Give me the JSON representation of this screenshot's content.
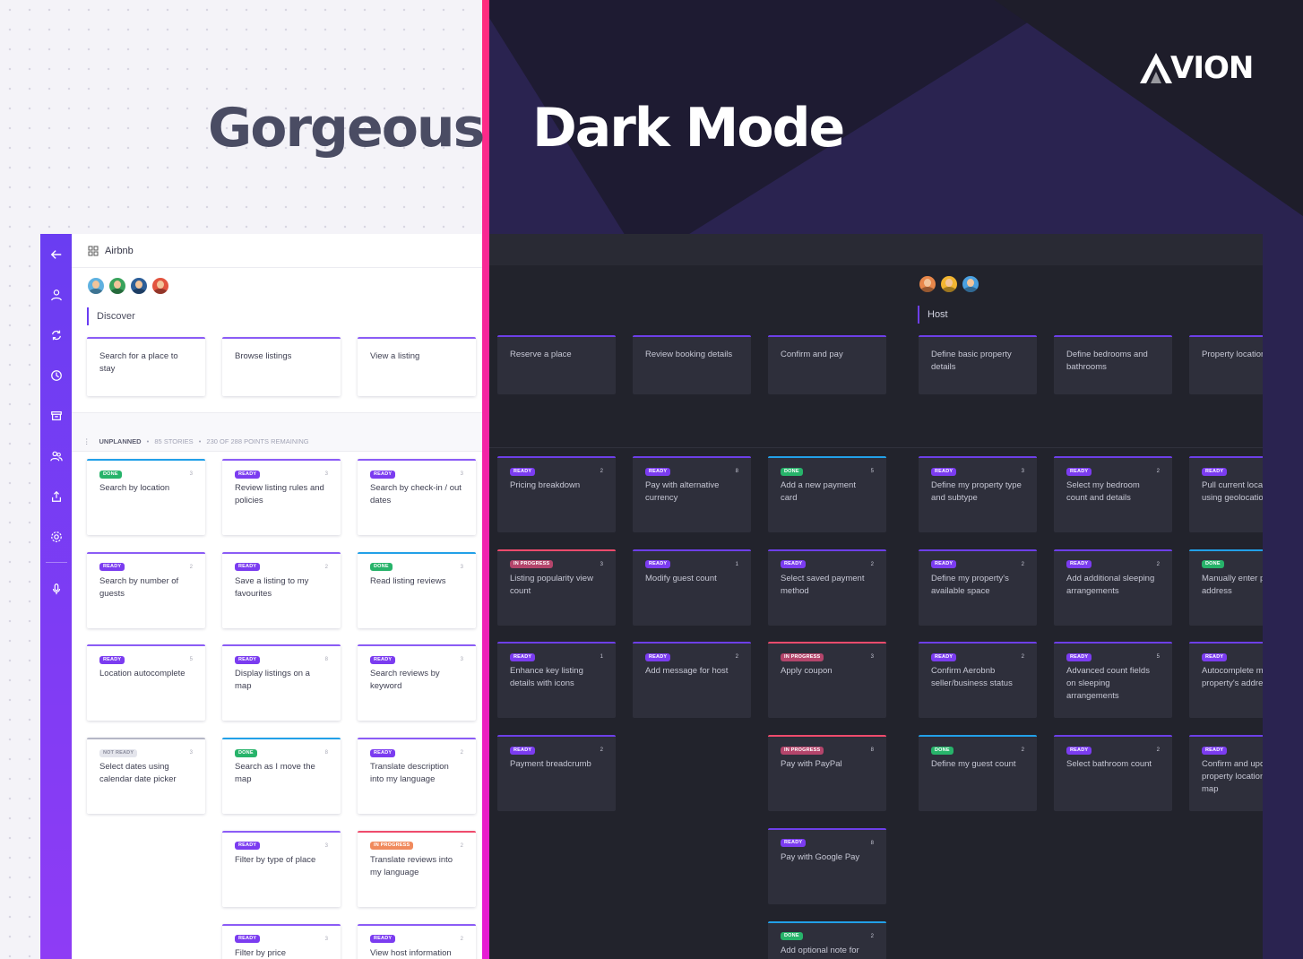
{
  "headline_left": "Gorgeous",
  "headline_right": "Dark Mode",
  "brand": "VION",
  "light_app": {
    "project": "Airbnb",
    "activity": "Discover",
    "steps": [
      "Search for a place to stay",
      "Browse listings",
      "View a listing"
    ],
    "unplanned": {
      "label": "UNPLANNED",
      "stories": "85 STORIES",
      "points": "230 OF 288 POINTS REMAINING"
    },
    "columns": [
      [
        {
          "status": "DONE",
          "pts": "3",
          "title": "Search by location"
        },
        {
          "status": "READY",
          "pts": "2",
          "title": "Search by number of guests"
        },
        {
          "status": "READY",
          "pts": "5",
          "title": "Location autocomplete"
        },
        {
          "status": "NOT READY",
          "pts": "3",
          "title": "Select dates using calendar date picker"
        }
      ],
      [
        {
          "status": "READY",
          "pts": "3",
          "title": "Review listing rules and policies"
        },
        {
          "status": "READY",
          "pts": "2",
          "title": "Save a listing to my favourites"
        },
        {
          "status": "READY",
          "pts": "8",
          "title": "Display listings on a map"
        },
        {
          "status": "DONE",
          "pts": "8",
          "title": "Search as I move the map"
        },
        {
          "status": "READY",
          "pts": "3",
          "title": "Filter by type of place"
        },
        {
          "status": "READY",
          "pts": "3",
          "title": "Filter by price"
        }
      ],
      [
        {
          "status": "READY",
          "pts": "3",
          "title": "Search by check-in / out dates"
        },
        {
          "status": "DONE",
          "pts": "3",
          "title": "Read listing reviews"
        },
        {
          "status": "READY",
          "pts": "3",
          "title": "Search reviews by keyword"
        },
        {
          "status": "READY",
          "pts": "2",
          "title": "Translate description into my language"
        },
        {
          "status": "IN PROGRESS",
          "pts": "2",
          "title": "Translate reviews into my language"
        },
        {
          "status": "READY",
          "pts": "2",
          "title": "View host information"
        }
      ]
    ]
  },
  "dark_app": {
    "activity": "Host",
    "steps": [
      "Reserve a place",
      "Review booking details",
      "Confirm and pay",
      "Define basic property details",
      "Define bedrooms and bathrooms",
      "Property location"
    ],
    "columns": [
      [
        {
          "status": "READY",
          "pts": "2",
          "title": "Pricing breakdown"
        },
        {
          "status": "IN PROGRESS",
          "pts": "3",
          "title": "Listing popularity view count"
        },
        {
          "status": "READY",
          "pts": "1",
          "title": "Enhance key listing details with icons"
        },
        {
          "status": "READY",
          "pts": "2",
          "title": "Payment breadcrumb"
        }
      ],
      [
        {
          "status": "READY",
          "pts": "8",
          "title": "Pay with alternative currency"
        },
        {
          "status": "READY",
          "pts": "1",
          "title": "Modify guest count"
        },
        {
          "status": "READY",
          "pts": "2",
          "title": "Add message for host"
        }
      ],
      [
        {
          "status": "DONE",
          "pts": "5",
          "title": "Add a new payment card"
        },
        {
          "status": "READY",
          "pts": "2",
          "title": "Select saved payment method"
        },
        {
          "status": "IN PROGRESS",
          "pts": "3",
          "title": "Apply coupon"
        },
        {
          "status": "IN PROGRESS",
          "pts": "8",
          "title": "Pay with PayPal"
        },
        {
          "status": "READY",
          "pts": "8",
          "title": "Pay with Google Pay"
        },
        {
          "status": "DONE",
          "pts": "2",
          "title": "Add optional note for"
        }
      ],
      [
        {
          "status": "READY",
          "pts": "3",
          "title": "Define my property type and subtype"
        },
        {
          "status": "READY",
          "pts": "2",
          "title": "Define my property's available space"
        },
        {
          "status": "READY",
          "pts": "2",
          "title": "Confirm Aerobnb seller/business status"
        },
        {
          "status": "DONE",
          "pts": "2",
          "title": "Define my guest count"
        }
      ],
      [
        {
          "status": "READY",
          "pts": "2",
          "title": "Select my bedroom count and details"
        },
        {
          "status": "READY",
          "pts": "2",
          "title": "Add additional sleeping arrangements"
        },
        {
          "status": "READY",
          "pts": "5",
          "title": "Advanced count fields on sleeping arrangements"
        },
        {
          "status": "READY",
          "pts": "2",
          "title": "Select bathroom count"
        }
      ],
      [
        {
          "status": "READY",
          "pts": "",
          "title": "Pull current location using geolocation"
        },
        {
          "status": "DONE",
          "pts": "",
          "title": "Manually enter property address"
        },
        {
          "status": "READY",
          "pts": "",
          "title": "Autocomplete my property's address"
        },
        {
          "status": "READY",
          "pts": "",
          "title": "Confirm and update property location on map"
        }
      ]
    ]
  },
  "colors": {
    "accent": "#6a3df2",
    "ready": "#7b3cf0",
    "done": "#27b36a",
    "in_progress": "#f08a5d",
    "in_progress_border": "#ef4b6c",
    "done_border": "#22a0e8"
  },
  "sidebar_icons": [
    "back-arrow-icon",
    "user-icon",
    "sync-icon",
    "clock-icon",
    "archive-icon",
    "team-icon",
    "share-icon",
    "settings-icon",
    "microphone-icon"
  ]
}
